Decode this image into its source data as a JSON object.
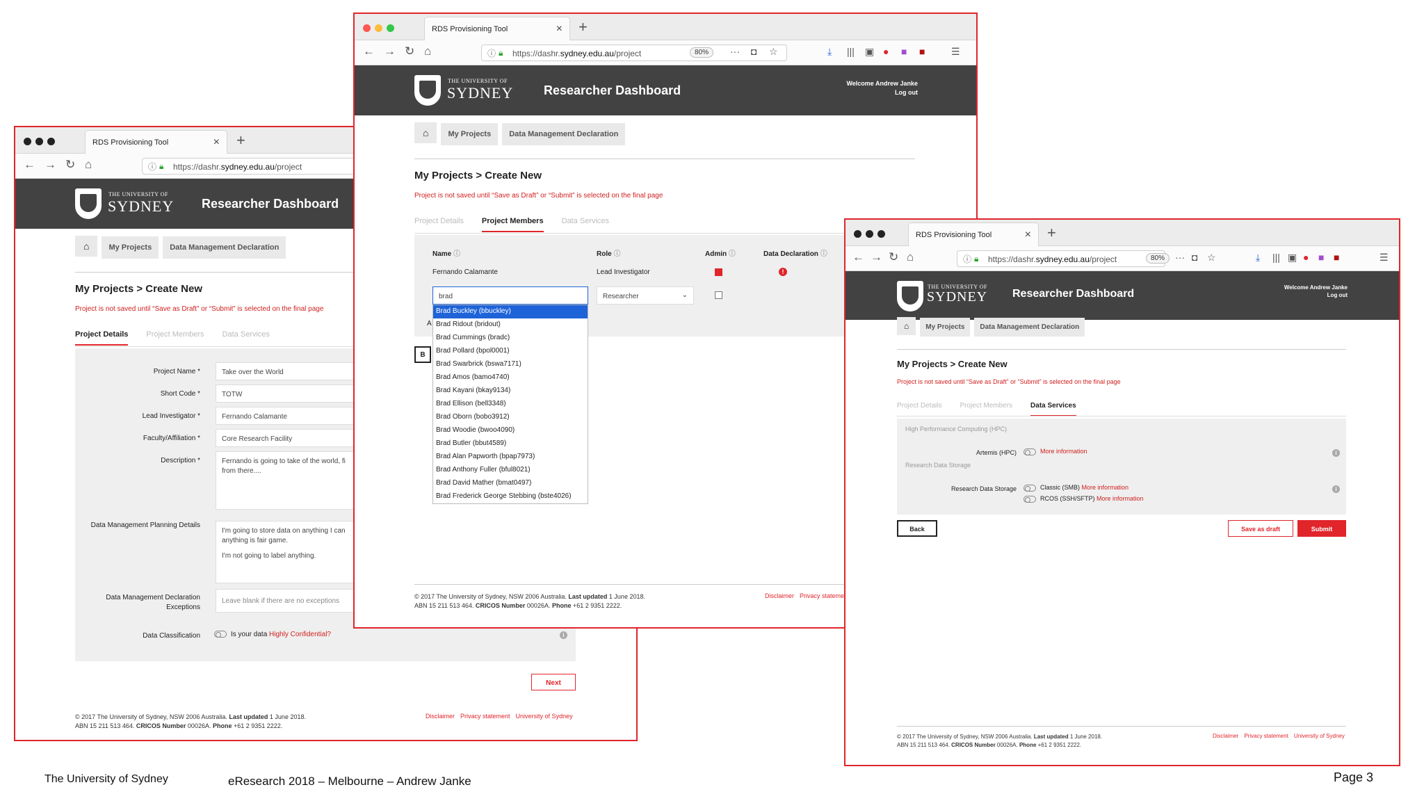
{
  "browser": {
    "tab_title": "RDS Provisioning Tool",
    "url_prefix": "https://dashr.",
    "url_domain": "sydney.edu.au",
    "url_suffix": "/project",
    "zoom": "80%"
  },
  "site": {
    "uni_small": "THE UNIVERSITY OF",
    "uni_big": "SYDNEY",
    "dashboard_title": "Researcher Dashboard",
    "welcome": "Welcome Andrew Janke",
    "logout": "Log out"
  },
  "crumbs": {
    "my_projects": "My Projects",
    "dmd": "Data Management Declaration"
  },
  "page": {
    "title": "My Projects > Create New",
    "warning": "Project is not saved until “Save as Draft” or “Submit” is selected on the final page",
    "tabs": [
      "Project Details",
      "Project Members",
      "Data Services"
    ]
  },
  "details": {
    "project_name_label": "Project Name *",
    "project_name": "Take over the World",
    "short_code_label": "Short Code *",
    "short_code": "TOTW",
    "lead_label": "Lead Investigator *",
    "lead": "Fernando Calamante",
    "faculty_label": "Faculty/Affiliation *",
    "faculty": "Core Research Facility",
    "description_label": "Description *",
    "description": "Fernando is going to take of the world, fi from there....",
    "dmp_label": "Data Management Planning Details",
    "dmp_line1": "I'm going to store data on anything I can anything is fair game.",
    "dmp_line2": "I'm not going to label anything.",
    "dmd_ex_label": "Data Management Declaration Exceptions",
    "dmd_ex_placeholder": "Leave blank if there are no exceptions",
    "class_label": "Data Classification",
    "class_q_prefix": "Is your data ",
    "class_q_link": "Highly Confidential?",
    "next": "Next"
  },
  "members": {
    "col_name": "Name",
    "col_role": "Role",
    "col_admin": "Admin",
    "col_decl": "Data Declaration",
    "row1_name": "Fernando Calamante",
    "row1_role": "Lead Investigator",
    "search_value": "brad",
    "role_select": "Researcher",
    "stub_a": "A",
    "stub_b": "B",
    "options": [
      "Brad Buckley (bbuckley)",
      "Brad Ridout (bridout)",
      "Brad Cummings (bradc)",
      "Brad Pollard (bpol0001)",
      "Brad Swarbrick (bswa7171)",
      "Brad Amos (bamo4740)",
      "Brad Kayani (bkay9134)",
      "Brad Ellison (bell3348)",
      "Brad Oborn (bobo3912)",
      "Brad Woodie (bwoo4090)",
      "Brad Butler (bbut4589)",
      "Brad Alan Papworth (bpap7973)",
      "Brad Anthony Fuller (bful8021)",
      "Brad David Mather (bmat0497)",
      "Brad Frederick George Stebbing (bste4026)"
    ]
  },
  "services": {
    "hpc_section": "High Performance Computing (HPC)",
    "artemis_label": "Artemis (HPC)",
    "more_info": "More information",
    "rds_section": "Research Data Storage",
    "rds_label": "Research Data Storage",
    "classic": "Classic (SMB) ",
    "rcos": "RCOS (SSH/SFTP) ",
    "back": "Back",
    "save_draft": "Save as draft",
    "submit": "Submit"
  },
  "footer": {
    "line1_a": "© 2017 The University of Sydney, NSW 2006 Australia. ",
    "line1_b": "Last updated",
    "line1_c": " 1 June 2018.",
    "line2_a": "ABN 15 211 513 464. ",
    "line2_b": "CRICOS Number",
    "line2_c": " 00026A. ",
    "line2_d": "Phone",
    "line2_e": " +61 2 9351 2222.",
    "disclaimer": "Disclaimer",
    "privacy": "Privacy statement",
    "privacy_cut": "Privacy stateme",
    "uos": "University of Sydney"
  },
  "slide": {
    "left": "The University of Sydney",
    "center": "eResearch 2018 – Melbourne – Andrew Janke",
    "page": "Page 3"
  },
  "colors": {
    "accent": "#e0252b",
    "header": "#424242",
    "select": "#1e63d8"
  }
}
